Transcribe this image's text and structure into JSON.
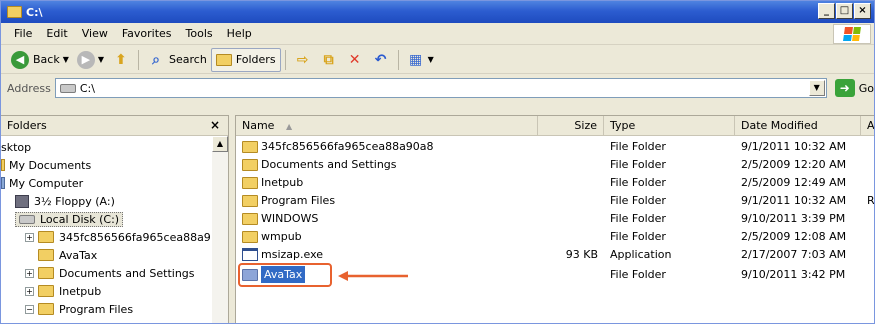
{
  "window": {
    "title": "C:\\",
    "buttons": {
      "minimize": "_",
      "maximize": "□",
      "close": "×"
    }
  },
  "menu": [
    "File",
    "Edit",
    "View",
    "Favorites",
    "Tools",
    "Help"
  ],
  "toolbar": {
    "back": "Back",
    "search": "Search",
    "folders": "Folders"
  },
  "address": {
    "label": "Address",
    "value": "C:\\",
    "go": "Go"
  },
  "folders_pane": {
    "header": "Folders",
    "close": "×",
    "items": [
      {
        "label": "sktop",
        "indent": 0,
        "icon": "none"
      },
      {
        "label": "My Documents",
        "indent": 0,
        "icon": "folder-icon"
      },
      {
        "label": "My Computer",
        "indent": 0,
        "icon": "computer-icon"
      },
      {
        "label": "3½ Floppy (A:)",
        "indent": 1,
        "icon": "floppy-icon"
      },
      {
        "label": "Local Disk (C:)",
        "indent": 1,
        "icon": "drive-icon"
      },
      {
        "label": "345fc856566fa965cea88a9",
        "indent": 2,
        "icon": "folder-icon",
        "expander": "+"
      },
      {
        "label": "AvaTax",
        "indent": 2,
        "icon": "folder-icon"
      },
      {
        "label": "Documents and Settings",
        "indent": 2,
        "icon": "folder-icon",
        "expander": "+"
      },
      {
        "label": "Inetpub",
        "indent": 2,
        "icon": "folder-icon",
        "expander": "+"
      },
      {
        "label": "Program Files",
        "indent": 2,
        "icon": "folder-icon",
        "expander": "−"
      }
    ]
  },
  "files": {
    "columns": [
      "Name",
      "Size",
      "Type",
      "Date Modified",
      "Attributes"
    ],
    "sort_indicator": "▲",
    "rows": [
      {
        "name": "345fc856566fa965cea88a90a8",
        "size": "",
        "type": "File Folder",
        "date": "9/1/2011 10:32 AM",
        "attr": ""
      },
      {
        "name": "Documents and Settings",
        "size": "",
        "type": "File Folder",
        "date": "2/5/2009 12:20 AM",
        "attr": ""
      },
      {
        "name": "Inetpub",
        "size": "",
        "type": "File Folder",
        "date": "2/5/2009 12:49 AM",
        "attr": ""
      },
      {
        "name": "Program Files",
        "size": "",
        "type": "File Folder",
        "date": "9/1/2011 10:32 AM",
        "attr": "R"
      },
      {
        "name": "WINDOWS",
        "size": "",
        "type": "File Folder",
        "date": "9/10/2011 3:39 PM",
        "attr": ""
      },
      {
        "name": "wmpub",
        "size": "",
        "type": "File Folder",
        "date": "2/5/2009 12:08 AM",
        "attr": ""
      },
      {
        "name": "msizap.exe",
        "size": "93 KB",
        "type": "Application",
        "date": "2/17/2007 7:03 AM",
        "attr": ""
      },
      {
        "name": "AvaTax",
        "size": "",
        "type": "File Folder",
        "date": "9/10/2011 3:42 PM",
        "attr": ""
      }
    ]
  },
  "colors": {
    "titlebar": "#2c5dd0",
    "selection": "#316ac5",
    "callout": "#e8622f"
  }
}
